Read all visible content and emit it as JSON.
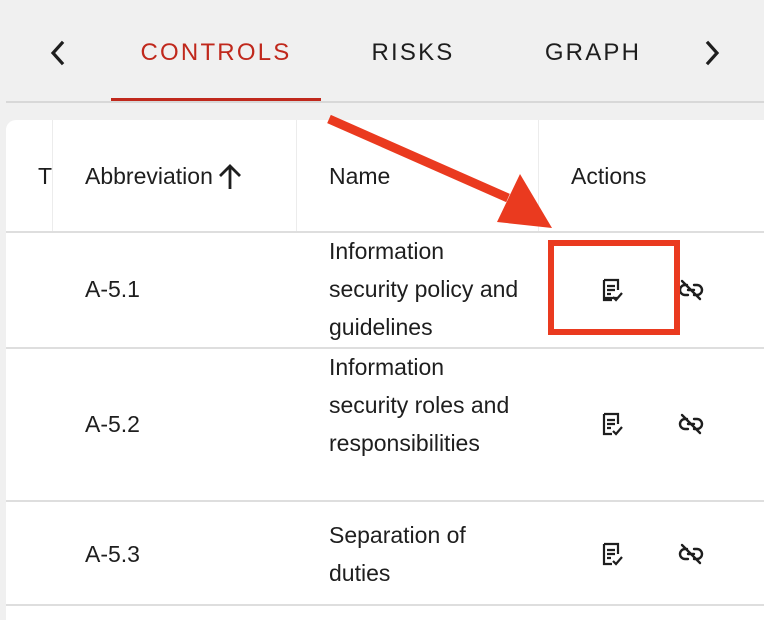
{
  "tabs": {
    "prev_icon": "chevron-left-icon",
    "next_icon": "chevron-right-icon",
    "items": [
      {
        "label": "CONTROLS",
        "active": true
      },
      {
        "label": "RISKS",
        "active": false
      },
      {
        "label": "GRAPH",
        "active": false
      }
    ]
  },
  "table": {
    "columns": {
      "type": "T",
      "abbreviation": "Abbreviation",
      "name": "Name",
      "actions": "Actions"
    },
    "sort": {
      "column": "abbreviation",
      "direction": "ascending",
      "icon": "arrow-up-icon"
    },
    "rows": [
      {
        "abbreviation": "A-5.1",
        "name": "Information security policy and guidelines",
        "actions": [
          "review-checklist-icon",
          "unlink-icon"
        ]
      },
      {
        "abbreviation": "A-5.2",
        "name": "Information security roles and responsibilities",
        "actions": [
          "review-checklist-icon",
          "unlink-icon"
        ]
      },
      {
        "abbreviation": "A-5.3",
        "name": "Separation of duties",
        "actions": [
          "review-checklist-icon",
          "unlink-icon"
        ]
      }
    ]
  },
  "annotation": {
    "color": "#ea3a1f",
    "target": "row 1 review-checklist-icon"
  },
  "colors": {
    "accent": "#c0281c",
    "text": "#1e1e1e",
    "background": "#f0f0f0",
    "surface": "#ffffff"
  }
}
